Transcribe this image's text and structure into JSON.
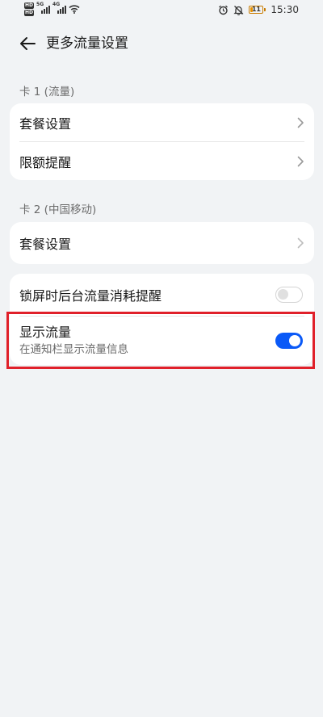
{
  "status_bar": {
    "sim1_tag": "HD",
    "sim2_tag": "HD",
    "sim1_net": "5G",
    "sim2_net": "4G",
    "battery_level": "11",
    "time": "15:30"
  },
  "header": {
    "title": "更多流量设置"
  },
  "section_card1": {
    "label": "卡 1 (流量)",
    "items": [
      {
        "label": "套餐设置"
      },
      {
        "label": "限额提醒"
      }
    ]
  },
  "section_card2": {
    "label": "卡 2 (中国移动)",
    "items": [
      {
        "label": "套餐设置"
      }
    ]
  },
  "toggles": {
    "lock_screen_alert": {
      "label": "锁屏时后台流量消耗提醒",
      "enabled": false
    },
    "show_traffic": {
      "label": "显示流量",
      "sublabel": "在通知栏显示流量信息",
      "enabled": true
    }
  },
  "colors": {
    "accent": "#0a59f7",
    "highlight": "#e0202a",
    "background": "#f1f3f5"
  }
}
